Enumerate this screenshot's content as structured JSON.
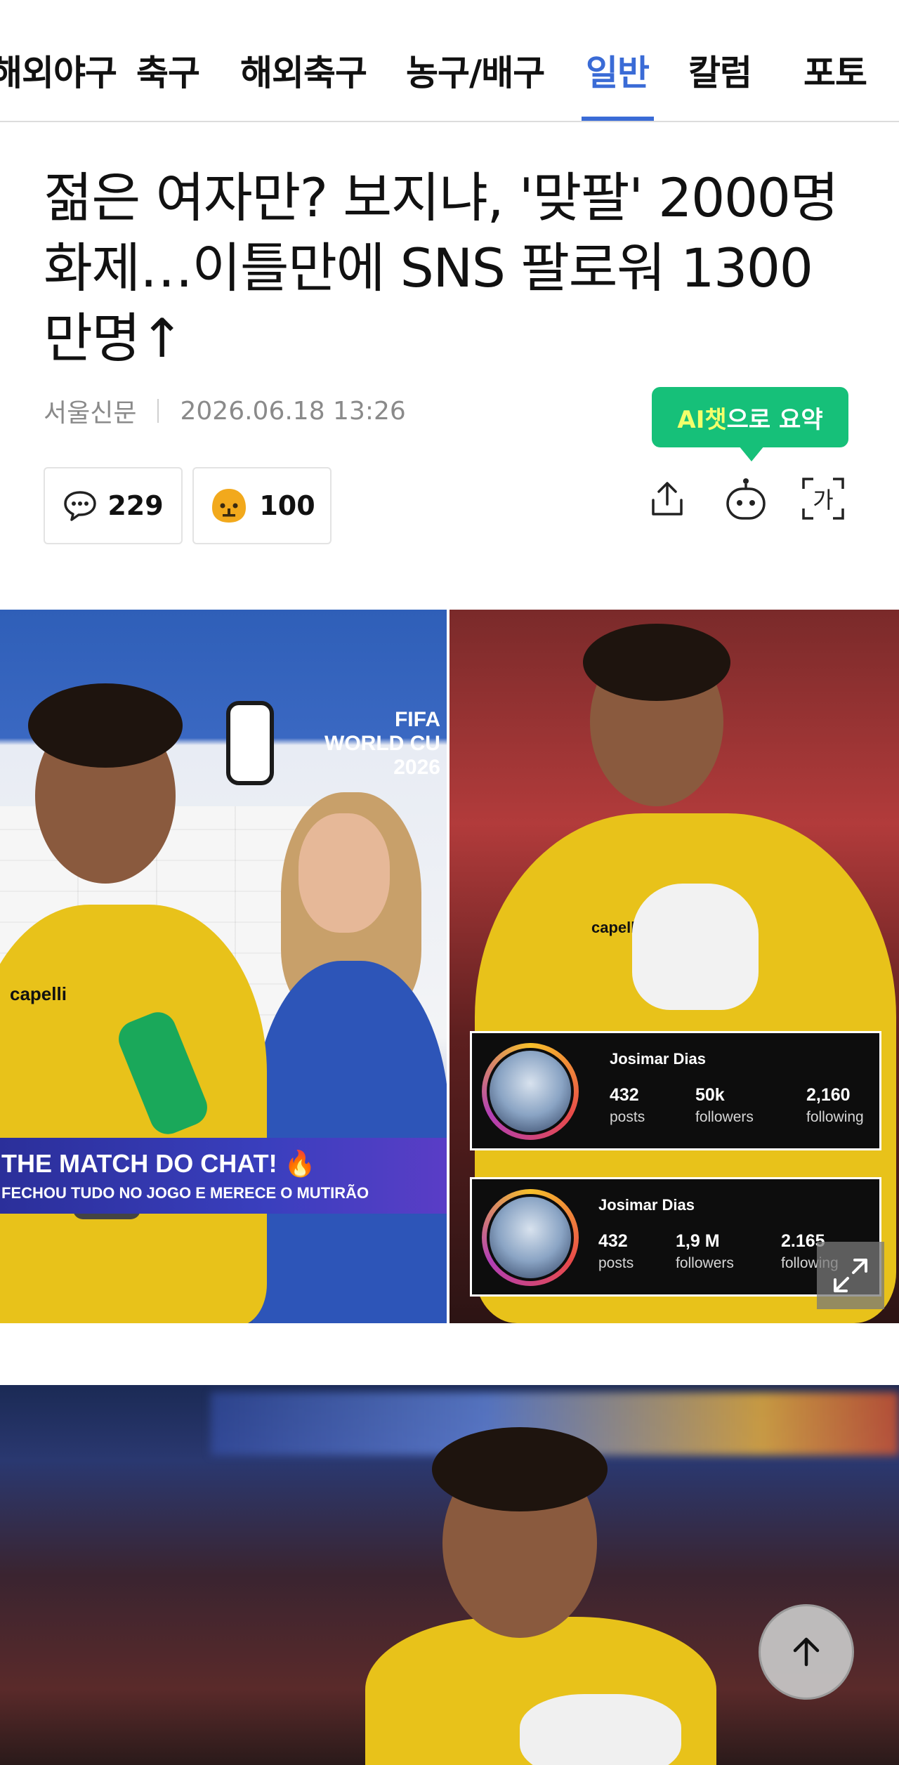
{
  "tabs": [
    {
      "label": "해외야구",
      "active": false
    },
    {
      "label": "축구",
      "active": false
    },
    {
      "label": "해외축구",
      "active": false
    },
    {
      "label": "농구/배구",
      "active": false
    },
    {
      "label": "일반",
      "active": true
    },
    {
      "label": "칼럼",
      "active": false
    },
    {
      "label": "포토",
      "active": false
    }
  ],
  "colors": {
    "accent": "#3a6bd6",
    "ai_green": "#16c079"
  },
  "article": {
    "headline": "젊은 여자만? 보지냐, '맞팔' 2000명 화제…이틀만에 SNS 팔로워 1300만명↑",
    "source": "서울신문",
    "datetime": "2026.06.18 13:26"
  },
  "ai_summary": {
    "ai": "AI챗",
    "rest": "으로 요약"
  },
  "reactions": {
    "comment_count": "229",
    "recommend_count": "100",
    "comment_icon": "speech-bubble-icon",
    "recommend_icon": "reaction-emoji-icon"
  },
  "toolbar": {
    "share_icon": "share-icon",
    "ai_bot_icon": "robot-icon",
    "font_size_label": "가"
  },
  "photo1": {
    "fifa_badge": [
      "FIFA",
      "WORLD CU",
      "2026"
    ],
    "banner_title": "THE MATCH DO CHAT! 🔥",
    "banner_sub": "FECHOU TUDO NO JOGO E MERECE O MUTIRÃO",
    "jersey_brand": "capelli",
    "ig_cards": [
      {
        "name": "Josimar Dias",
        "posts": "432",
        "posts_label": "posts",
        "followers": "50k",
        "followers_label": "followers",
        "following": "2,160",
        "following_label": "following"
      },
      {
        "name": "Josimar Dias",
        "posts": "432",
        "posts_label": "posts",
        "followers": "1,9 M",
        "followers_label": "followers",
        "following": "2.165",
        "following_label": "following"
      }
    ]
  }
}
